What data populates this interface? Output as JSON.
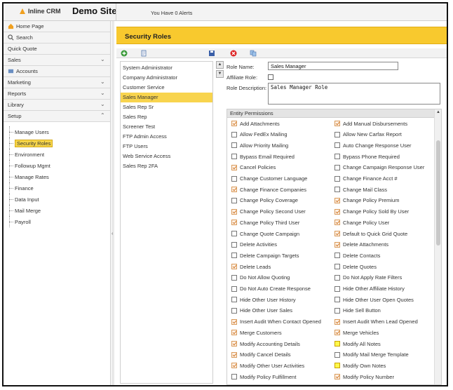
{
  "header": {
    "app_name": "Inline CRM",
    "site_title": "Demo Site",
    "alerts": "You Have 0 Alerts"
  },
  "nav": {
    "home": "Home Page",
    "search": "Search",
    "quick_quote": "Quick Quote",
    "sales": "Sales",
    "accounts": "Accounts",
    "marketing": "Marketing",
    "reports": "Reports",
    "library": "Library",
    "setup": "Setup",
    "setup_items": [
      "Manage Users",
      "Security Roles",
      "Environment",
      "Followup Mgmt",
      "Manage Rates",
      "Finance",
      "Data Input",
      "Mail Merge",
      "Payroll"
    ]
  },
  "main": {
    "title": "Security Roles"
  },
  "roles": [
    "System Administrator",
    "Company Administrator",
    "Customer Service",
    "Sales Manager",
    "Sales Rep Sr",
    "Sales Rep",
    "Screener Test",
    "FTP Admin Access",
    "FTP Users",
    "Web Service Access",
    "Sales Rep 2FA"
  ],
  "form": {
    "role_name_label": "Role Name:",
    "role_name_value": "Sales Manager",
    "affiliate_label": "Affiliate Role:",
    "description_label": "Role Description:",
    "description_value": "Sales Manager Role"
  },
  "permissions_title": "Entity Permissions",
  "permissions_left": [
    {
      "label": "Add Attachments",
      "state": "on"
    },
    {
      "label": "Allow FedEx Mailing",
      "state": "off"
    },
    {
      "label": "Allow Priority Mailing",
      "state": "off"
    },
    {
      "label": "Bypass Email Required",
      "state": "off"
    },
    {
      "label": "Cancel Policies",
      "state": "on"
    },
    {
      "label": "Change Customer Language",
      "state": "off"
    },
    {
      "label": "Change Finance Companies",
      "state": "on"
    },
    {
      "label": "Change Policy Coverage",
      "state": "off"
    },
    {
      "label": "Change Policy Second User",
      "state": "on"
    },
    {
      "label": "Change Policy Third User",
      "state": "on"
    },
    {
      "label": "Change Quote Campaign",
      "state": "off"
    },
    {
      "label": "Delete Activities",
      "state": "off"
    },
    {
      "label": "Delete Campaign Targets",
      "state": "off"
    },
    {
      "label": "Delete Leads",
      "state": "on"
    },
    {
      "label": "Do Not Allow Quoting",
      "state": "off"
    },
    {
      "label": "Do Not Auto Create Response",
      "state": "off"
    },
    {
      "label": "Hide Other User History",
      "state": "off"
    },
    {
      "label": "Hide Other User Sales",
      "state": "off"
    },
    {
      "label": "Insert Audit When Contact Opened",
      "state": "on"
    },
    {
      "label": "Merge Customers",
      "state": "on"
    },
    {
      "label": "Modify Accounting Details",
      "state": "on"
    },
    {
      "label": "Modify Cancel Details",
      "state": "on"
    },
    {
      "label": "Modify Other User Activities",
      "state": "on"
    },
    {
      "label": "Modify Policy Fulfillment",
      "state": "off"
    }
  ],
  "permissions_right": [
    {
      "label": "Add Manual Disbursements",
      "state": "on"
    },
    {
      "label": "Allow New Carfax Report",
      "state": "off"
    },
    {
      "label": "Auto Change Response User",
      "state": "off"
    },
    {
      "label": "Bypass Phone Required",
      "state": "off"
    },
    {
      "label": "Change Campaign Response User",
      "state": "off"
    },
    {
      "label": "Change Finance Acct #",
      "state": "off"
    },
    {
      "label": "Change Mail Class",
      "state": "off"
    },
    {
      "label": "Change Policy Premium",
      "state": "on"
    },
    {
      "label": "Change Policy Sold By User",
      "state": "on"
    },
    {
      "label": "Change Policy User",
      "state": "on"
    },
    {
      "label": "Default to Quick Grid Quote",
      "state": "on"
    },
    {
      "label": "Delete Attachments",
      "state": "on"
    },
    {
      "label": "Delete Contacts",
      "state": "off"
    },
    {
      "label": "Delete Quotes",
      "state": "off"
    },
    {
      "label": "Do Not Apply Rate Filters",
      "state": "off"
    },
    {
      "label": "Hide Other Affiliate History",
      "state": "off"
    },
    {
      "label": "Hide Other User Open Quotes",
      "state": "off"
    },
    {
      "label": "Hide Sell Button",
      "state": "off"
    },
    {
      "label": "Insert Audit When Lead Opened",
      "state": "on"
    },
    {
      "label": "Merge Vehicles",
      "state": "on"
    },
    {
      "label": "Modify All Notes",
      "state": "highlight"
    },
    {
      "label": "Modify Mail Merge Template",
      "state": "off"
    },
    {
      "label": "Modify Own Notes",
      "state": "highlight"
    },
    {
      "label": "Modify Policy Number",
      "state": "on"
    }
  ]
}
